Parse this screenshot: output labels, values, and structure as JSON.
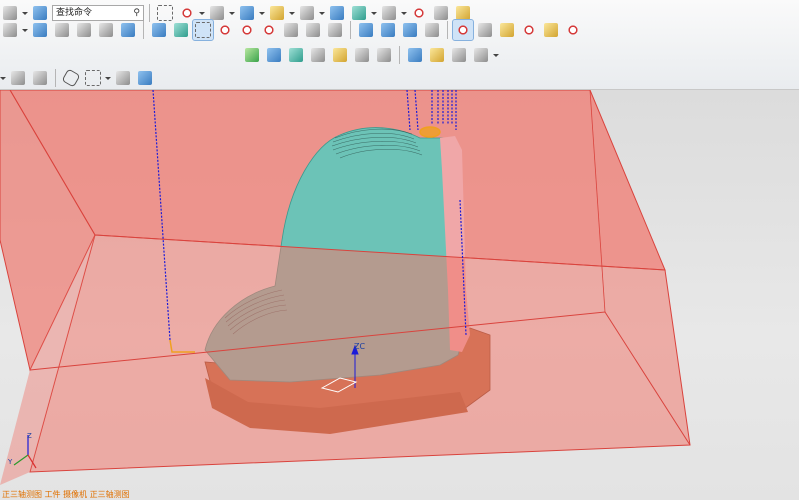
{
  "search": {
    "value": "查找命令"
  },
  "viewport": {
    "wcs_label": "ZC",
    "triad_labels": {
      "z": "Z",
      "y": "Y"
    }
  },
  "status_bar": {
    "text": "正三轴测图 工件 摄像机 正三轴测图"
  },
  "colors": {
    "blank_box": "#f07a70",
    "part_teal": "#6cc3b7",
    "base_copper": "#b8683a",
    "toolpath": "#1b1bd8",
    "highlight_face": "#f0a7a8"
  },
  "toolbar": {
    "row1_icons": [
      "list-icon",
      "sketch-icon",
      "search-icon",
      "collapse-icon",
      "fit-icon",
      "shaded-icon",
      "cube-icon",
      "render-icon",
      "box-icon",
      "layer-icon",
      "view-icon",
      "measure-icon",
      "wcs-icon",
      "snap-icon",
      "ruler-icon"
    ],
    "row2_icons": [
      "refresh-icon",
      "generate-icon",
      "verify-icon",
      "simulate-icon",
      "postprocess-icon",
      "shop-doc-icon",
      "stock-icon",
      "circle-icon",
      "curve-icon",
      "program-icon",
      "method-icon",
      "tool-icon",
      "geometry-icon",
      "operation-icon",
      "display-icon",
      "machine-icon",
      "clearance-icon",
      "noncutting-icon",
      "feeds-icon",
      "cutpattern-icon",
      "options-icon",
      "object-icon",
      "transform-icon"
    ],
    "row3_icons": [
      "check-icon",
      "assembly-icon",
      "tree-icon",
      "table-icon",
      "analysis-icon",
      "annotate-icon",
      "report-icon",
      "list-view-icon",
      "feature-icon",
      "clock-icon",
      "export-icon"
    ],
    "row4_icons": [
      "undo-arrow-icon",
      "wcs-rotate-icon",
      "hexagon-icon",
      "dashed-box-icon",
      "printer-icon",
      "solid-cube-icon"
    ]
  }
}
